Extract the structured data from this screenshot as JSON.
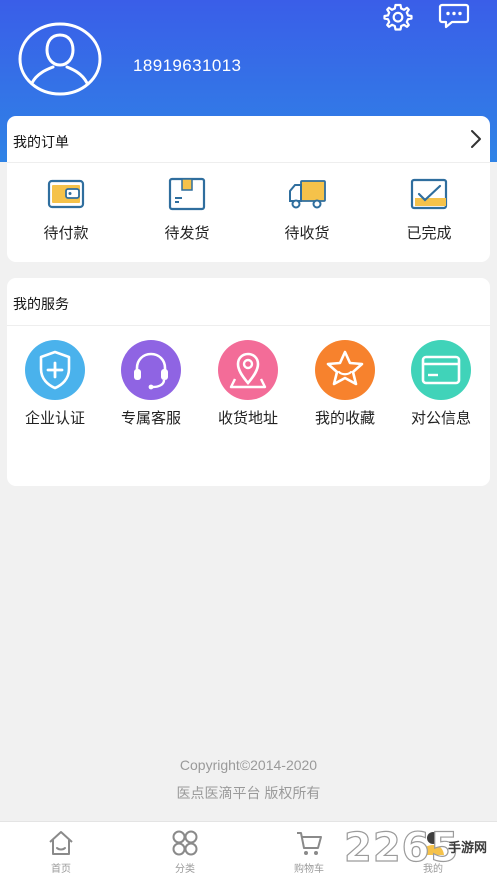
{
  "header": {
    "phone": "18919631013",
    "icons": {
      "settings": "gear-icon",
      "messages": "chat-bubble-icon",
      "avatar": "user-avatar-icon"
    }
  },
  "orders": {
    "title": "我的订单",
    "items": [
      {
        "label": "待付款",
        "icon": "wallet-icon"
      },
      {
        "label": "待发货",
        "icon": "package-box-icon"
      },
      {
        "label": "待收货",
        "icon": "delivery-truck-icon"
      },
      {
        "label": "已完成",
        "icon": "completed-check-icon"
      }
    ]
  },
  "services": {
    "title": "我的服务",
    "items": [
      {
        "label": "企业认证",
        "icon": "shield-plus-icon",
        "color": "#4ab2ec"
      },
      {
        "label": "专属客服",
        "icon": "headset-icon",
        "color": "#8f64e3"
      },
      {
        "label": "收货地址",
        "icon": "map-pin-icon",
        "color": "#f36c98"
      },
      {
        "label": "我的收藏",
        "icon": "star-icon",
        "color": "#f7822d"
      },
      {
        "label": "对公信息",
        "icon": "card-icon",
        "color": "#40d3b9"
      }
    ]
  },
  "footer": {
    "copyright": "Copyright©2014-2020",
    "company": "医点医滴平台 版权所有"
  },
  "tabbar": {
    "items": [
      {
        "label": "首页",
        "icon": "home-icon"
      },
      {
        "label": "分类",
        "icon": "category-icon"
      },
      {
        "label": "购物车",
        "icon": "cart-icon"
      },
      {
        "label": "我的",
        "icon": "user-icon"
      }
    ]
  },
  "watermark": {
    "number": "2265",
    "text": "手游网"
  },
  "colors": {
    "header_top": "#3a5ee8",
    "header_bottom": "#2f83e6",
    "background": "#f1f1f1",
    "accent": "#2f83e6"
  }
}
